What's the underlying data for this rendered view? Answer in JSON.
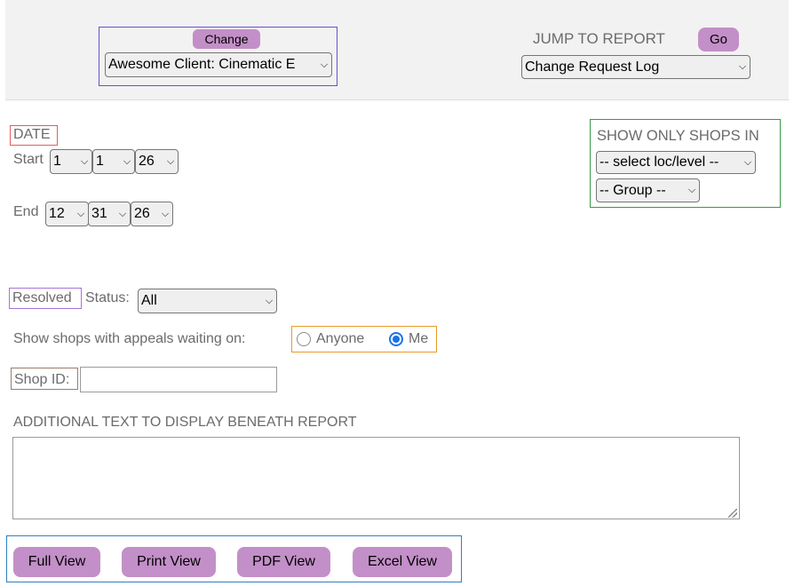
{
  "header": {
    "change_label": "Change",
    "client_select": "Awesome Client: Cinematic E",
    "jump_label": "JUMP TO REPORT",
    "go_label": "Go",
    "report_select": "Change Request Log"
  },
  "date": {
    "heading": "DATE",
    "start_label": "Start",
    "start_month": "1",
    "start_day": "1",
    "start_year": "26",
    "end_label": "End",
    "end_month": "12",
    "end_day": "31",
    "end_year": "26"
  },
  "shops_filter": {
    "heading": "SHOW ONLY SHOPS IN",
    "loc_select": "-- select loc/level --",
    "group_select": "-- Group --"
  },
  "resolved": {
    "label": "Resolved",
    "status_label": "Status:",
    "status_value": "All"
  },
  "appeals": {
    "label": "Show shops with appeals waiting on:",
    "option_anyone": "Anyone",
    "option_me": "Me",
    "selected": "Me"
  },
  "shop_id": {
    "label": "Shop ID:",
    "value": ""
  },
  "additional_text": {
    "label": "ADDITIONAL TEXT TO DISPLAY BENEATH REPORT",
    "value": ""
  },
  "views": {
    "full": "Full View",
    "print": "Print View",
    "pdf": "PDF View",
    "excel": "Excel View"
  }
}
